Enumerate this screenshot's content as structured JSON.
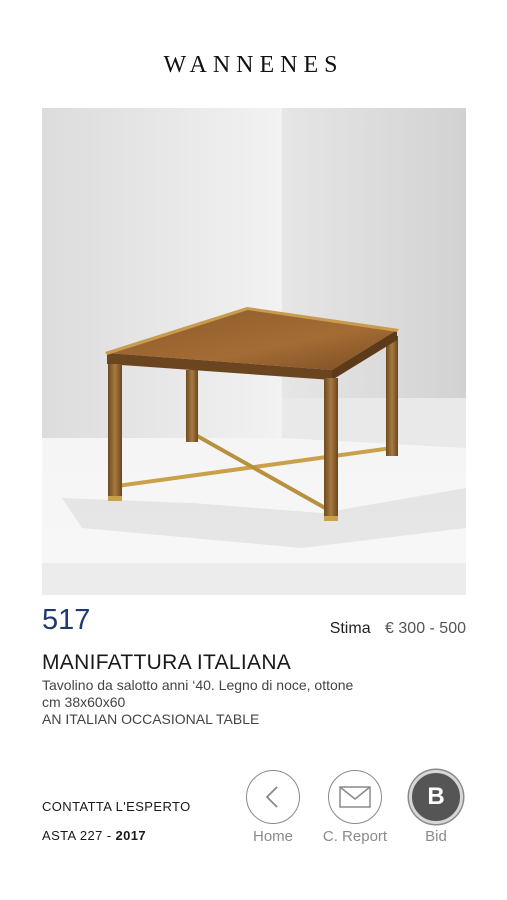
{
  "brand": {
    "name": "WANNENES"
  },
  "lot": {
    "number": "517",
    "estimate_label": "Stima",
    "estimate_value": "€ 300 - 500",
    "title": "MANIFATTURA ITALIANA",
    "description": [
      "Tavolino da salotto anni ‘40. Legno di noce, ottone",
      "cm 38x60x60",
      "AN ITALIAN OCCASIONAL TABLE"
    ]
  },
  "footer": {
    "contact_label": "CONTATTA L'ESPERTO",
    "auction_prefix": "ASTA 227 - ",
    "auction_year": "2017"
  },
  "nav": {
    "home_label": "Home",
    "report_label": "C. Report",
    "bid_label": "Bid",
    "bid_letter": "B"
  },
  "colors": {
    "lot_number": "#1f3a6e",
    "bid_circle": "#555555",
    "nav_grey": "#8a8a8a"
  }
}
